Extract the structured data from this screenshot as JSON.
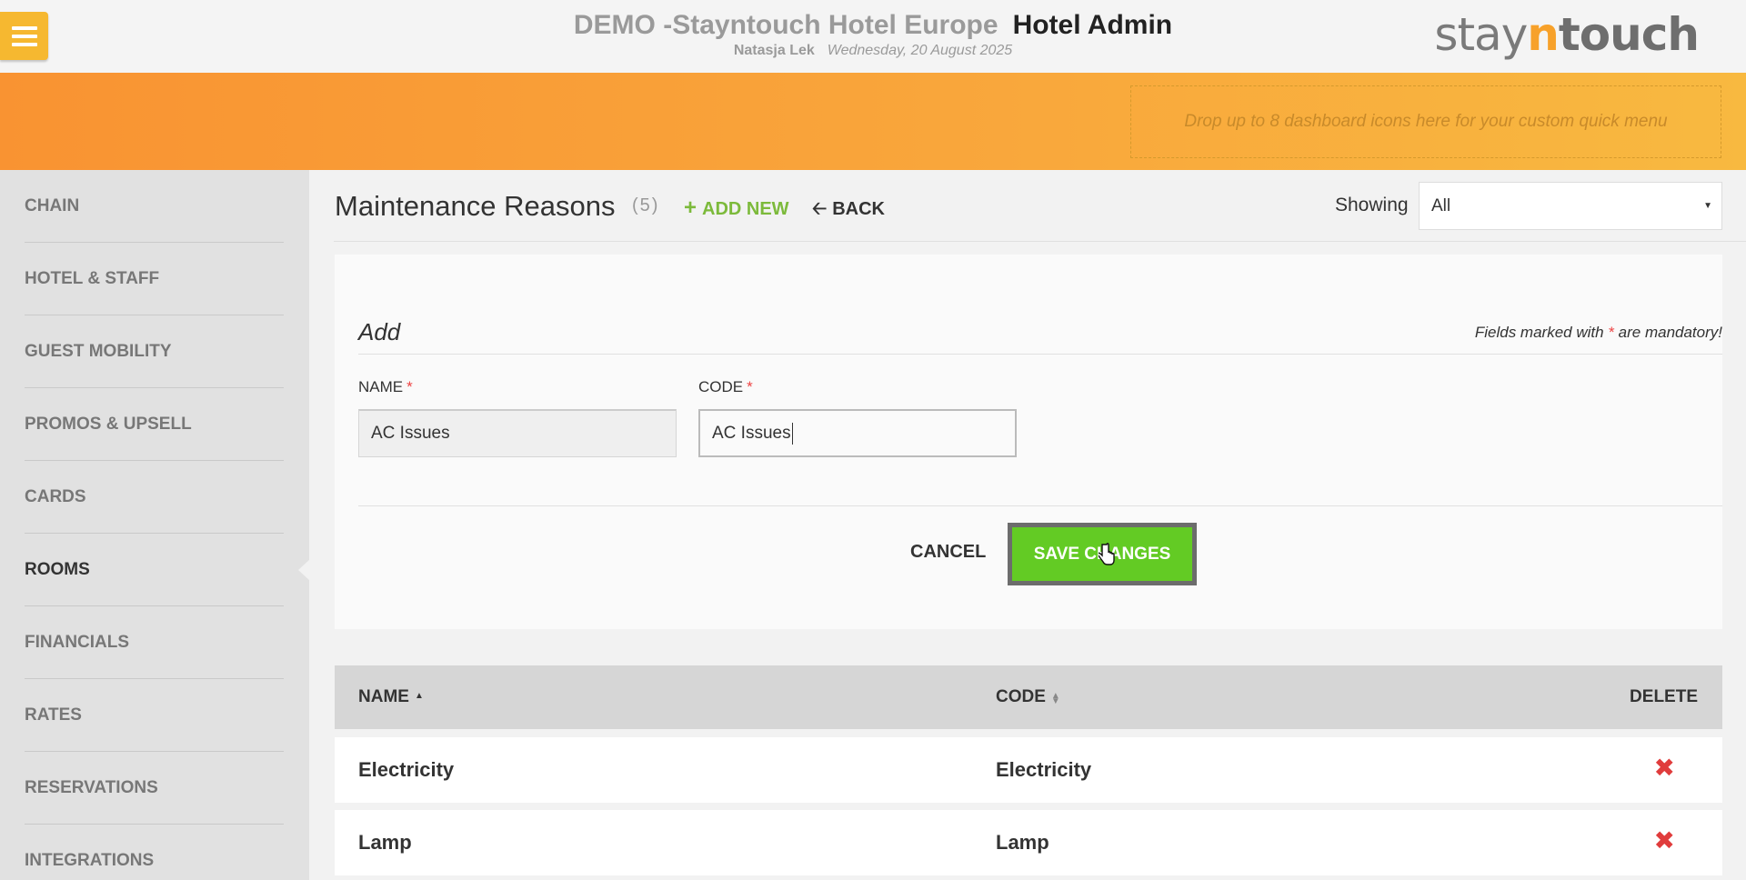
{
  "header": {
    "hotel_name": "DEMO -Stayntouch Hotel Europe",
    "app_name": "Hotel Admin",
    "user_name": "Natasja Lek",
    "date": "Wednesday, 20 August 2025",
    "logo": {
      "part1": "stay",
      "part2": "n",
      "part3": "touch"
    }
  },
  "quick_menu": {
    "placeholder": "Drop up to 8 dashboard icons here for your custom quick menu"
  },
  "sidebar": {
    "items": [
      {
        "label": "CHAIN"
      },
      {
        "label": "HOTEL & STAFF"
      },
      {
        "label": "GUEST MOBILITY"
      },
      {
        "label": "PROMOS & UPSELL"
      },
      {
        "label": "CARDS"
      },
      {
        "label": "ROOMS"
      },
      {
        "label": "FINANCIALS"
      },
      {
        "label": "RATES"
      },
      {
        "label": "RESERVATIONS"
      },
      {
        "label": "INTEGRATIONS"
      }
    ],
    "active": "ROOMS"
  },
  "page": {
    "title": "Maintenance Reasons",
    "count": "(5)",
    "add_new_label": "ADD NEW",
    "back_label": "BACK",
    "showing_label": "Showing",
    "showing_value": "All"
  },
  "form": {
    "title": "Add",
    "mandatory_prefix": "Fields marked with",
    "mandatory_star": "*",
    "mandatory_suffix": "are mandatory!",
    "name_label": "NAME",
    "code_label": "CODE",
    "required_star": "*",
    "name_value": "AC Issues",
    "code_value": "AC Issues",
    "cancel_label": "CANCEL",
    "save_label": "SAVE CHANGES"
  },
  "table": {
    "headers": {
      "name": "NAME",
      "code": "CODE",
      "delete": "DELETE"
    },
    "rows": [
      {
        "name": "Electricity",
        "code": "Electricity"
      },
      {
        "name": "Lamp",
        "code": "Lamp"
      }
    ]
  },
  "colors": {
    "accent_orange": "#f99332",
    "menu_yellow": "#f6b830",
    "add_green": "#7cba3b",
    "save_green": "#63cb24",
    "delete_red": "#e03c3c"
  },
  "icons": {
    "menu": "hamburger-icon",
    "add": "plus-icon",
    "back": "arrow-left-icon",
    "sort_asc": "sort-up-icon",
    "sort": "sort-icon",
    "delete": "close-icon",
    "cursor": "hand-pointer-icon"
  }
}
